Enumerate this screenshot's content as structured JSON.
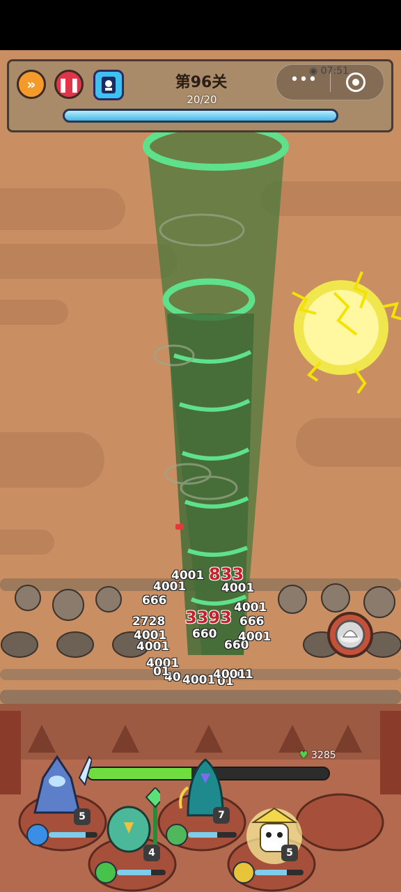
{
  "hud": {
    "level_title": "第96关",
    "wave_count": "20/20",
    "wave_progress": 1.0,
    "clock": "07:51"
  },
  "buttons": {
    "fast_forward_icon": "double-chevron-icon",
    "pause_icon": "pause-icon"
  },
  "damage_numbers": [
    "4001",
    "833",
    "4001",
    "666",
    "4001",
    "2728",
    "3393",
    "666",
    "4001",
    "660",
    "4001",
    "660",
    "4001",
    "4001",
    "4001",
    "4001",
    "40",
    "01",
    "01",
    "01",
    "4001"
  ],
  "team": {
    "hp_value": "3285",
    "hp_fraction": 0.43,
    "heroes": [
      {
        "name": "ice-knight",
        "level": "5",
        "skill_color": "#3a8ee6"
      },
      {
        "name": "green-bird-mage",
        "level": "4",
        "skill_color": "#47c24a"
      },
      {
        "name": "teal-wind-spirit",
        "level": "7",
        "skill_color": "#4fb85a"
      },
      {
        "name": "yellow-thunder-panda",
        "level": "5",
        "skill_color": "#e7c43a"
      }
    ]
  },
  "colors": {
    "sky": "#c98f63",
    "tornado": "#4f7a3c",
    "lightning": "#f4f04a"
  }
}
